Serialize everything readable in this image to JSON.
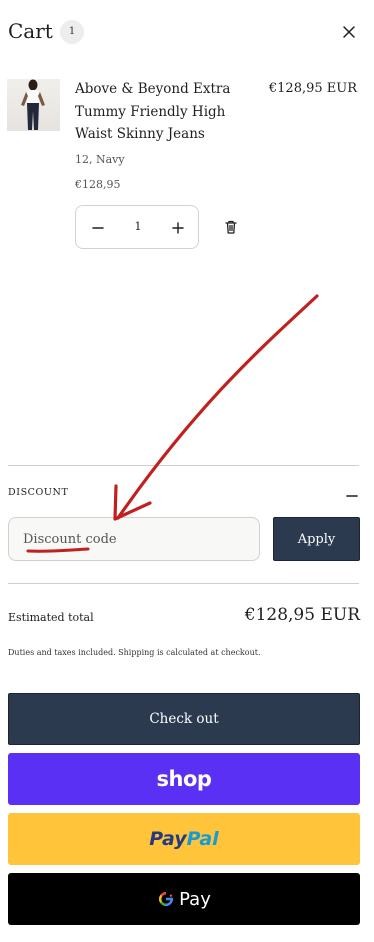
{
  "header": {
    "title": "Cart",
    "item_count": "1"
  },
  "item": {
    "title": "Above & Beyond Extra Tummy Friendly High Waist Skinny Jeans",
    "total_price": "€128,95 EUR",
    "variant": "12, Navy",
    "unit_price": "€128,95",
    "quantity": "1"
  },
  "discount": {
    "label": "DISCOUNT",
    "input_placeholder": "Discount code",
    "apply_label": "Apply"
  },
  "totals": {
    "estimated_label": "Estimated total",
    "estimated_value": "€128,95 EUR",
    "tax_note": "Duties and taxes included. Shipping is calculated at checkout."
  },
  "checkout": {
    "label": "Check out"
  },
  "express": {
    "shop_label": "shop",
    "paypal_part1": "Pay",
    "paypal_part2": "Pal",
    "gpay_label": "Pay"
  },
  "colors": {
    "primary_button": "#2b3a4e",
    "shop_pay": "#5a31f4",
    "paypal": "#ffc439",
    "gpay": "#000000",
    "annotation": "#c0201e"
  },
  "icons": [
    "close-icon",
    "minus-icon",
    "plus-icon",
    "trash-icon",
    "collapse-minus-icon",
    "google-g-icon"
  ]
}
